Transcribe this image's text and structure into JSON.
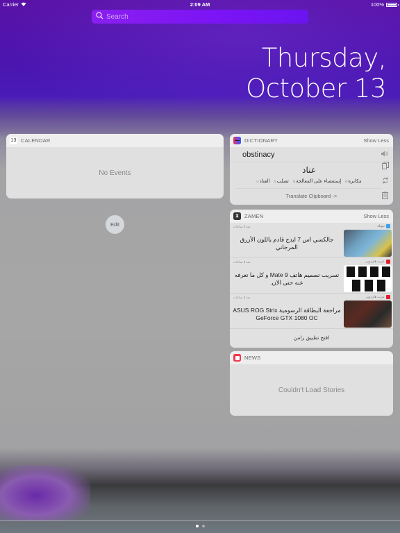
{
  "status_bar": {
    "carrier": "Carrier",
    "time": "2:09 AM",
    "battery": "100%"
  },
  "search": {
    "placeholder": "Search"
  },
  "date": {
    "weekday": "Thursday,",
    "month_day": "October 13"
  },
  "calendar": {
    "title": "CALENDAR",
    "icon_day": "13",
    "empty_text": "No Events"
  },
  "edit_button": "Edit",
  "dictionary": {
    "title": "DICTIONARY",
    "action": "Show Less",
    "word": "obstinacy",
    "translation": "عناد",
    "synonyms": [
      {
        "word": "مكابرة",
        "pos": "N"
      },
      {
        "word": "إستعصاء على المعالجة",
        "pos": "N"
      },
      {
        "word": "تصلب",
        "pos": "N"
      },
      {
        "word": "العناد",
        "pos": "U"
      }
    ],
    "footer": "Translate Clipboard ->"
  },
  "zamen": {
    "title": "ZAMEN",
    "action": "Show Less",
    "items": [
      {
        "time": "منذ 3 ساعات",
        "source": "تيوتك",
        "headline": "جالكسي اس 7 ايدج قادم باللون الأزرق المرجاني",
        "source_color": "#3aa0e8"
      },
      {
        "time": "منذ 3 ساعات",
        "source": "عرب هاردوير",
        "headline": "تسريب تصميم هاتف Mate 9 و كل ما تعرفه عنه حتى الان.",
        "source_color": "#e02030"
      },
      {
        "time": "منذ 4 ساعات",
        "source": "عرب هاردوير",
        "headline": "مراجعة البطاقة الرسومية ASUS ROG Strix GeForce GTX 1080 OC",
        "source_color": "#e02030"
      }
    ],
    "footer": "افتح تطبيق زامن"
  },
  "news": {
    "title": "NEWS",
    "empty_text": "Couldn't Load Stories"
  },
  "page_indicator": {
    "pages": 2,
    "current": 1
  }
}
